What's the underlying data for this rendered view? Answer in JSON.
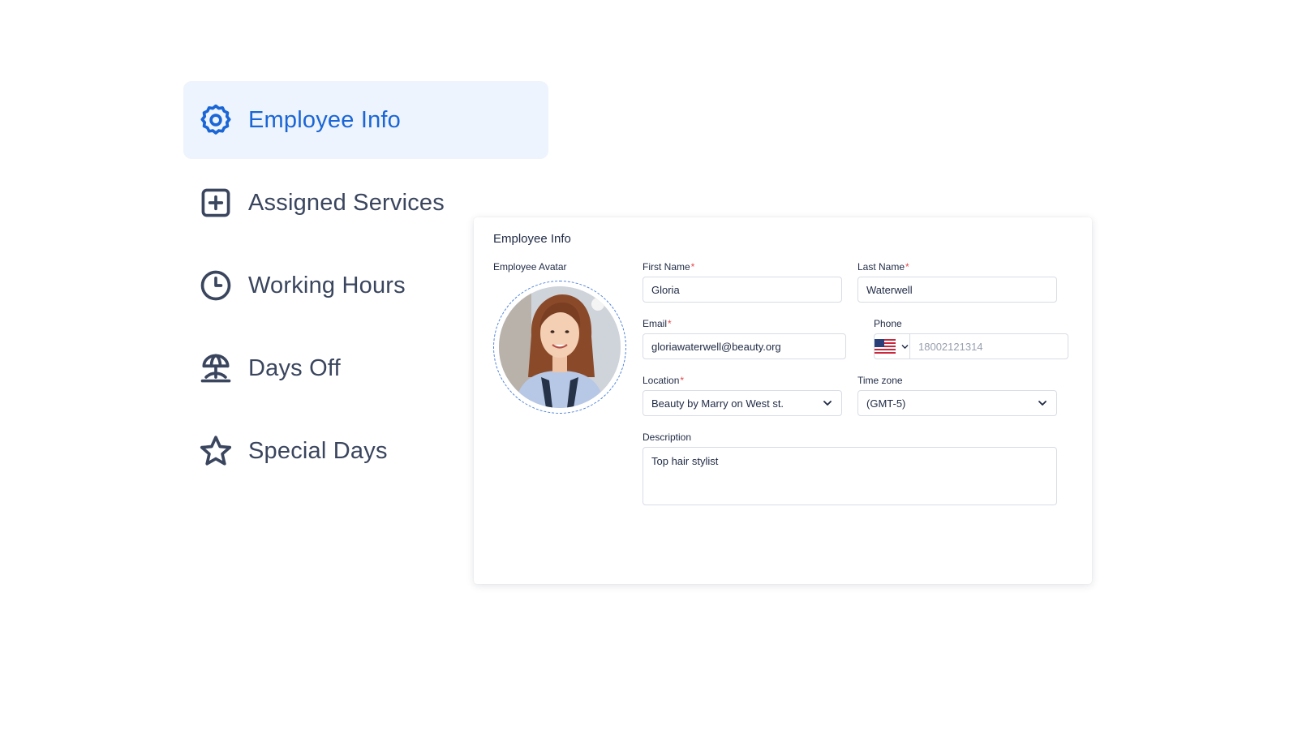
{
  "sidebar": {
    "items": [
      {
        "label": "Employee Info",
        "icon": "gear-icon",
        "active": true
      },
      {
        "label": "Assigned Services",
        "icon": "plus-square-icon",
        "active": false
      },
      {
        "label": "Working Hours",
        "icon": "clock-icon",
        "active": false
      },
      {
        "label": "Days Off",
        "icon": "island-icon",
        "active": false
      },
      {
        "label": "Special Days",
        "icon": "star-icon",
        "active": false
      }
    ]
  },
  "card": {
    "title": "Employee Info",
    "avatar_label": "Employee Avatar",
    "first_name": {
      "label": "First Name",
      "required": "*",
      "value": "Gloria"
    },
    "last_name": {
      "label": "Last Name",
      "required": "*",
      "value": "Waterwell"
    },
    "email": {
      "label": "Email",
      "required": "*",
      "value": "gloriawaterwell@beauty.org"
    },
    "phone": {
      "label": "Phone",
      "placeholder": "18002121314",
      "flag_icon": "us-flag-icon"
    },
    "location": {
      "label": "Location",
      "required": "*",
      "value": "Beauty by Marry on West st."
    },
    "timezone": {
      "label": "Time zone",
      "value": "(GMT-5)"
    },
    "description": {
      "label": "Description",
      "value": "Top hair stylist"
    }
  },
  "colors": {
    "accent": "#1a66d6",
    "active_bg": "#eef4fd",
    "nav_text": "#3a455e",
    "required": "#e5484d",
    "border": "#d8dce3"
  }
}
